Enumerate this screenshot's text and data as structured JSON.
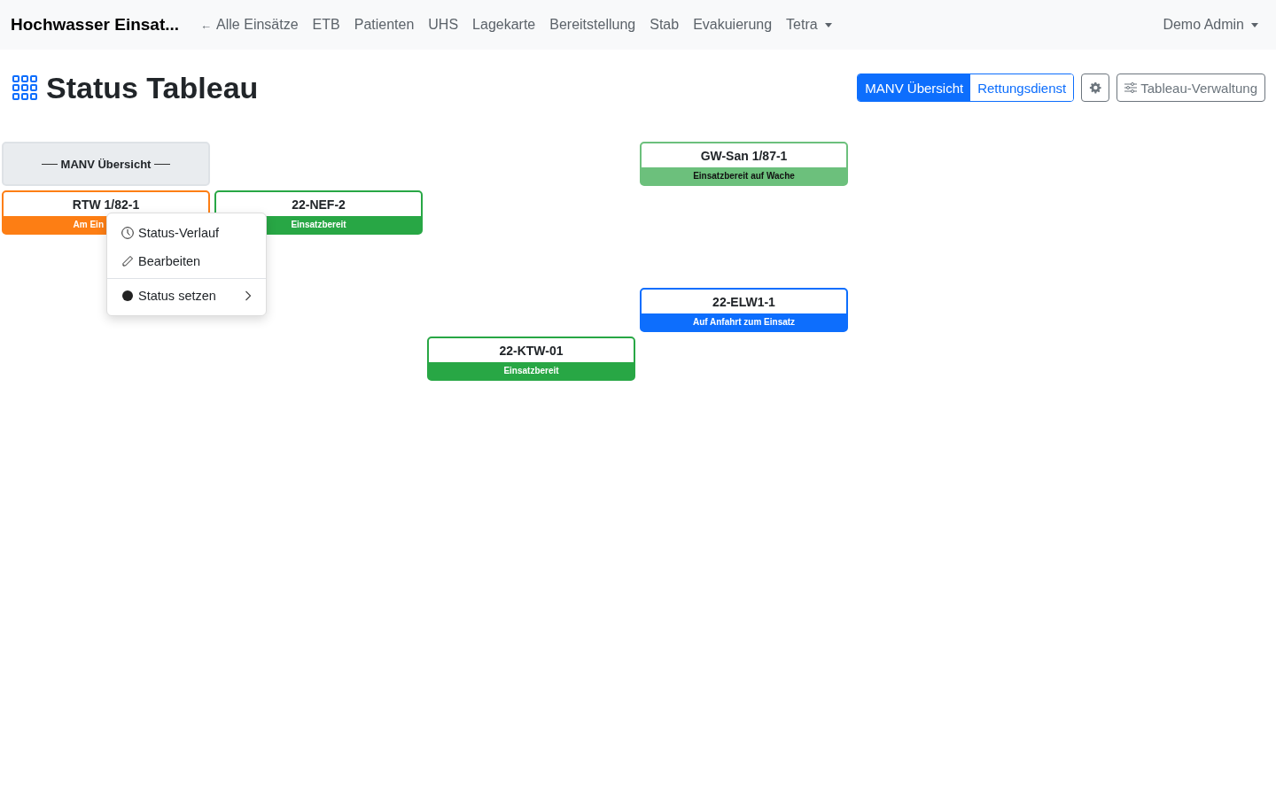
{
  "navbar": {
    "brand": "Hochwasser Einsat...",
    "back_link": {
      "arrow": "←",
      "label": "Alle Einsätze"
    },
    "links": [
      {
        "label": "ETB",
        "dropdown": false
      },
      {
        "label": "Patienten",
        "dropdown": false
      },
      {
        "label": "UHS",
        "dropdown": false
      },
      {
        "label": "Lagekarte",
        "dropdown": false
      },
      {
        "label": "Bereitstellung",
        "dropdown": false
      },
      {
        "label": "Stab",
        "dropdown": false
      },
      {
        "label": "Evakuierung",
        "dropdown": false
      },
      {
        "label": "Tetra",
        "dropdown": true
      }
    ],
    "user": {
      "label": "Demo Admin",
      "dropdown": true
    }
  },
  "header": {
    "title": "Status Tableau",
    "views": [
      {
        "label": "MANV Übersicht",
        "selected": true
      },
      {
        "label": "Rettungsdienst",
        "selected": false
      }
    ],
    "manage_button": "Tableau-Verwaltung"
  },
  "board": {
    "rows": [
      {
        "cells": [
          {
            "kind": "header",
            "label": "MANV Übersicht"
          },
          {
            "kind": "empty"
          },
          {
            "kind": "empty"
          },
          {
            "kind": "unit",
            "name": "GW-San 1/87-1",
            "status": "Einsatzbereit auf Wache",
            "color": "#6cc07c",
            "menu_open": false
          }
        ]
      },
      {
        "cells": [
          {
            "kind": "unit",
            "name": "RTW 1/82-1",
            "status": "Am Ein",
            "color": "#fd7e14",
            "menu_open": true
          },
          {
            "kind": "unit",
            "name": "22-NEF-2",
            "status": "Einsatzbereit",
            "color": "#28a745",
            "menu_open": false
          },
          {
            "kind": "empty"
          },
          {
            "kind": "empty"
          }
        ]
      },
      {
        "cells": [
          {
            "kind": "empty"
          },
          {
            "kind": "empty"
          },
          {
            "kind": "empty"
          },
          {
            "kind": "empty"
          }
        ]
      },
      {
        "cells": [
          {
            "kind": "empty"
          },
          {
            "kind": "empty"
          },
          {
            "kind": "empty"
          },
          {
            "kind": "unit",
            "name": "22-ELW1-1",
            "status": "Auf Anfahrt zum Einsatz",
            "color": "#0d6efd",
            "menu_open": false
          }
        ]
      },
      {
        "cells": [
          {
            "kind": "empty"
          },
          {
            "kind": "empty"
          },
          {
            "kind": "unit",
            "name": "22-KTW-01",
            "status": "Einsatzbereit",
            "color": "#28a745",
            "menu_open": false
          },
          {
            "kind": "empty"
          }
        ]
      }
    ]
  },
  "context_menu": {
    "items": [
      {
        "kind": "history",
        "label": "Status-Verlauf",
        "submenu": false
      },
      {
        "kind": "edit",
        "label": "Bearbeiten",
        "submenu": false
      },
      {
        "kind": "status",
        "label": "Status setzen",
        "submenu": true
      }
    ]
  }
}
